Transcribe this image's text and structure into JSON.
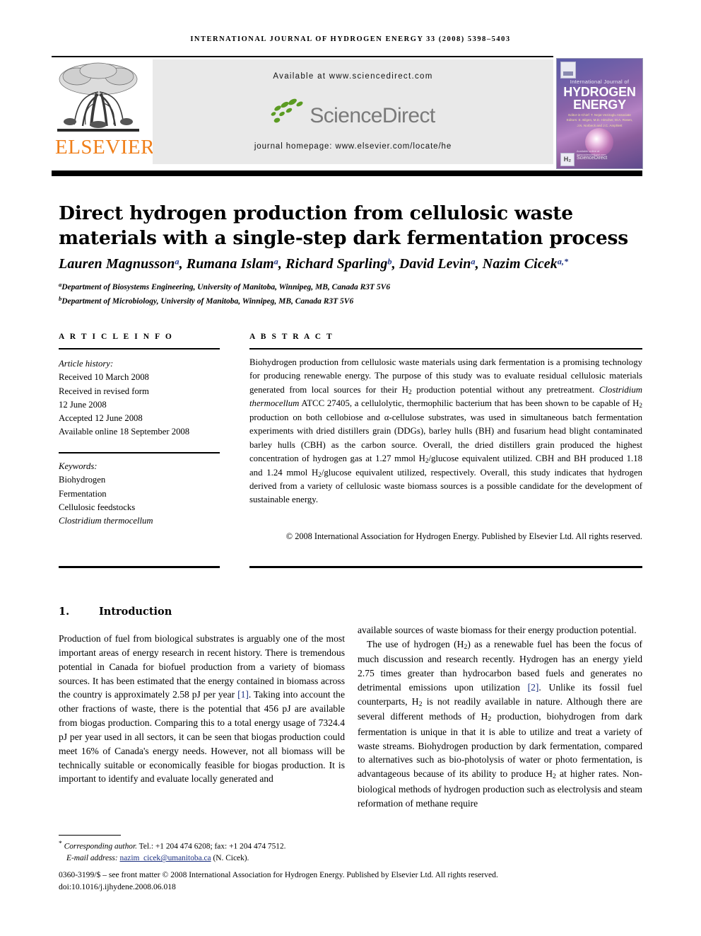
{
  "header": {
    "journal_reference": "INTERNATIONAL JOURNAL OF HYDROGEN ENERGY 33 (2008) 5398–5403",
    "elsevier_wordmark": "ELSEVIER",
    "available_at": "Available at www.sciencedirect.com",
    "sciencedirect_wordmark": "ScienceDirect",
    "journal_homepage": "journal homepage: www.elsevier.com/locate/he"
  },
  "cover": {
    "line1": "International Journal of",
    "line2": "HYDROGEN",
    "line3": "ENERGY",
    "editors": "Editor-in-Chief:  T. Nejat Veziroglu   Associate Editors:  E. Bilgen, M.D. Hirscher, M.A. Rosen, J.N. Norbeck and J.C. Amphlett",
    "hbox": "H₂",
    "sciencedirect": "ScienceDirect",
    "sd_tagline": "Available online at www.sciencedirect.com"
  },
  "article": {
    "title": "Direct hydrogen production from cellulosic waste materials with a single-step dark fermentation process",
    "authors_html": "Lauren Magnusson<sup>a</sup>, Rumana Islam<sup>a</sup>, Richard Sparling<sup>b</sup>, David Levin<sup>a</sup>, Nazim Cicek<sup>a,</sup><sup>*</sup>",
    "affiliations": [
      {
        "marker": "a",
        "text": "Department of Biosystems Engineering, University of Manitoba, Winnipeg, MB, Canada R3T 5V6"
      },
      {
        "marker": "b",
        "text": "Department of Microbiology, University of Manitoba, Winnipeg, MB, Canada R3T 5V6"
      }
    ]
  },
  "article_info": {
    "heading": "A R T I C L E   I N F O",
    "history_label": "Article history:",
    "history": [
      "Received 10 March 2008",
      "Received in revised form",
      "12 June 2008",
      "Accepted 12 June 2008",
      "Available online 18 September 2008"
    ],
    "keywords_label": "Keywords:",
    "keywords": [
      "Biohydrogen",
      "Fermentation",
      "Cellulosic feedstocks",
      "Clostridium thermocellum"
    ]
  },
  "abstract": {
    "heading": "A B S T R A C T",
    "body_html": "Biohydrogen production from cellulosic waste materials using dark fermentation is a promising technology for producing renewable energy. The purpose of this study was to evaluate residual cellulosic materials generated from local sources for their H<sub>2</sub> production potential without any pretreatment. <span class=\"sp\">Clostridium thermocellum</span> ATCC 27405, a cellulolytic, thermophilic bacterium that has been shown to be capable of H<sub>2</sub> production on both cellobiose and &#945;-cellulose substrates, was used in simultaneous batch fermentation experiments with dried distillers grain (DDGs), barley hulls (BH) and fusarium head blight contaminated barley hulls (CBH) as the carbon source. Overall, the dried distillers grain produced the highest concentration of hydrogen gas at 1.27 mmol H<sub>2</sub>/glucose equivalent utilized. CBH and BH produced 1.18 and 1.24 mmol H<sub>2</sub>/glucose equivalent utilized, respectively. Overall, this study indicates that hydrogen derived from a variety of cellulosic waste biomass sources is a possible candidate for the development of sustainable energy.",
    "copyright": "© 2008 International Association for Hydrogen Energy. Published by Elsevier Ltd. All rights reserved."
  },
  "introduction": {
    "number": "1.",
    "title": "Introduction",
    "left_column_html": "Production of fuel from biological substrates is arguably one of the most important areas of energy research in recent history. There is tremendous potential in Canada for biofuel production from a variety of biomass sources. It has been estimated that the energy contained in biomass across the country is approximately 2.58 pJ per year <span class=\"ref\">[1]</span>. Taking into account the other fractions of waste, there is the potential that 456 pJ are available from biogas production. Comparing this to a total energy usage of 7324.4 pJ per year used in all sectors, it can be seen that biogas production could meet 16% of Canada's energy needs. However, not all biomass will be technically suitable or economically feasible for biogas production. It is important to identify and evaluate locally generated and",
    "right_column_para1_html": "available sources of waste biomass for their energy production potential.",
    "right_column_para2_html": "The use of hydrogen (H<sub>2</sub>) as a renewable fuel has been the focus of much discussion and research recently. Hydrogen has an energy yield 2.75 times greater than hydrocarbon based fuels and generates no detrimental emissions upon utilization <span class=\"ref\">[2]</span>. Unlike its fossil fuel counterparts, H<sub>2</sub> is not readily available in nature. Although there are several different methods of H<sub>2</sub> production, biohydrogen from dark fermentation is unique in that it is able to utilize and treat a variety of waste streams. Biohydrogen production by dark fermentation, compared to alternatives such as bio-photolysis of water or photo fermentation, is advantageous because of its ability to produce H<sub>2</sub> at higher rates. Non-biological methods of hydrogen production such as electrolysis and steam reformation of methane require"
  },
  "footer": {
    "corresponding_marker": "*",
    "corresponding_label": "Corresponding author.",
    "corresponding_contact": "Tel.: +1 204 474 6208; fax: +1 204 474 7512.",
    "email_label": "E-mail address:",
    "email": "nazim_cicek@umanitoba.ca",
    "email_owner": "(N. Cicek).",
    "issn_line": "0360-3199/$ – see front matter © 2008 International Association for Hydrogen Energy. Published by Elsevier Ltd. All rights reserved.",
    "doi": "doi:10.1016/j.ijhydene.2008.06.018"
  },
  "colors": {
    "elsevier_orange": "#F07F1A",
    "sciencedirect_green": "#4E9A20",
    "sciencedirect_gray": "#7a7a7a",
    "link_blue": "#1b2f80",
    "panel_gray": "#e9e9e9"
  }
}
